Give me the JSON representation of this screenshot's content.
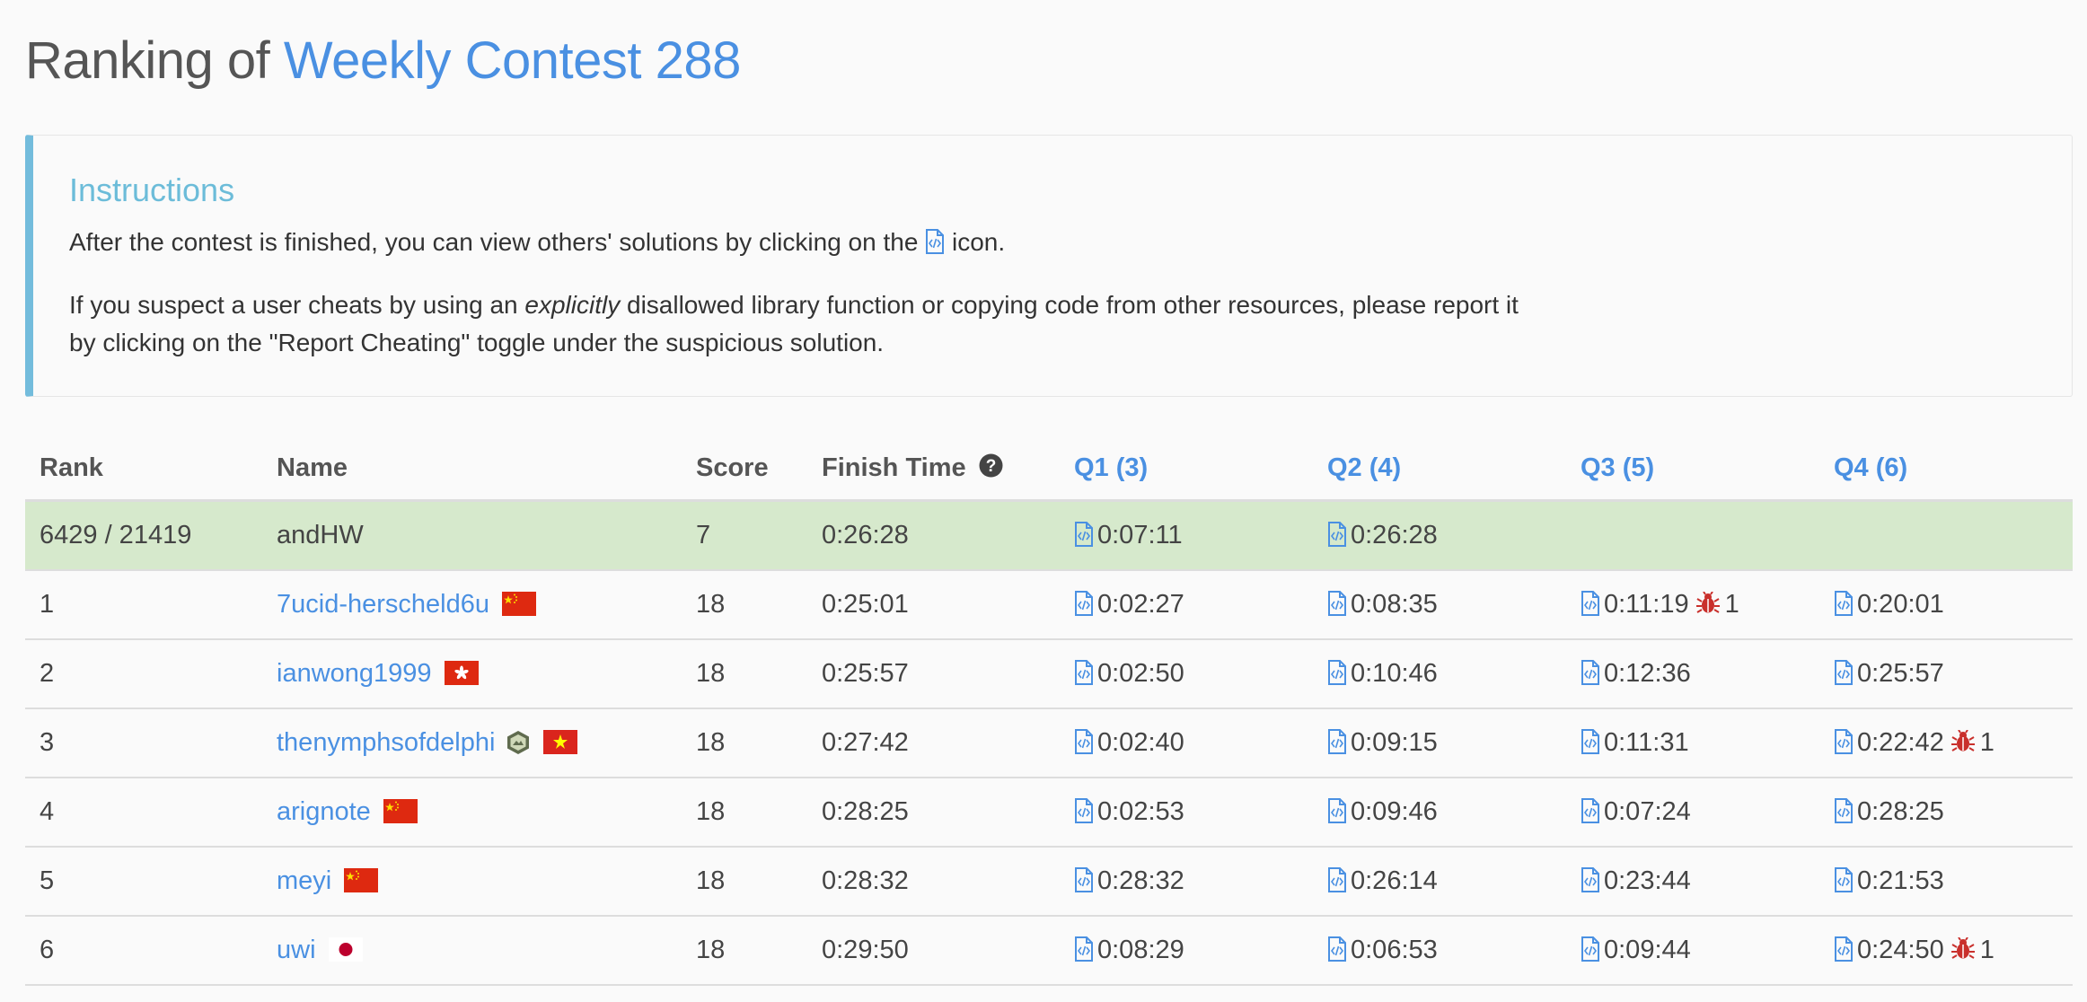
{
  "header": {
    "prefix": "Ranking of",
    "contest": "Weekly Contest 288"
  },
  "instructions": {
    "title": "Instructions",
    "p1_before": "After the contest is finished, you can view others' solutions by clicking on the",
    "p1_after": "icon.",
    "p2_before": "If you suspect a user cheats by using an",
    "p2_em": "explicitly",
    "p2_after": "disallowed library function or copying code from other resources, please report it by clicking on the \"Report Cheating\" toggle under the suspicious solution."
  },
  "table": {
    "headers": {
      "rank": "Rank",
      "name": "Name",
      "score": "Score",
      "finish": "Finish Time",
      "q1": "Q1 (3)",
      "q2": "Q2 (4)",
      "q3": "Q3 (5)",
      "q4": "Q4 (6)"
    },
    "me": {
      "rank": "6429 / 21419",
      "name": "andHW",
      "score": "7",
      "finish": "0:26:28",
      "q1": "0:07:11",
      "q2": "0:26:28",
      "q3": "",
      "q4": ""
    },
    "rows": [
      {
        "rank": "1",
        "name": "7ucid-herscheld6u",
        "flag": "cn-flag-icon",
        "score": "18",
        "finish": "0:25:01",
        "q1": "0:02:27",
        "q2": "0:08:35",
        "q3": "0:11:19",
        "q3_bugs": "1",
        "q4": "0:20:01"
      },
      {
        "rank": "2",
        "name": "ianwong1999",
        "flag": "hk-flag-icon",
        "score": "18",
        "finish": "0:25:57",
        "q1": "0:02:50",
        "q2": "0:10:46",
        "q3": "0:12:36",
        "q4": "0:25:57"
      },
      {
        "rank": "3",
        "name": "thenymphsofdelphi",
        "flag": "vn-flag-icon",
        "badge": "contest-badge-icon",
        "score": "18",
        "finish": "0:27:42",
        "q1": "0:02:40",
        "q2": "0:09:15",
        "q3": "0:11:31",
        "q4": "0:22:42",
        "q4_bugs": "1"
      },
      {
        "rank": "4",
        "name": "arignote",
        "flag": "cn-flag-icon",
        "score": "18",
        "finish": "0:28:25",
        "q1": "0:02:53",
        "q2": "0:09:46",
        "q3": "0:07:24",
        "q4": "0:28:25"
      },
      {
        "rank": "5",
        "name": "meyi",
        "flag": "cn-flag-icon",
        "score": "18",
        "finish": "0:28:32",
        "q1": "0:28:32",
        "q2": "0:26:14",
        "q3": "0:23:44",
        "q4": "0:21:53"
      },
      {
        "rank": "6",
        "name": "uwi",
        "flag": "jp-flag-icon",
        "score": "18",
        "finish": "0:29:50",
        "q1": "0:08:29",
        "q2": "0:06:53",
        "q3": "0:09:44",
        "q4": "0:24:50",
        "q4_bugs": "1"
      }
    ]
  },
  "colors": {
    "accent": "#4a90e2",
    "instructions_border": "#73bcdc",
    "highlight_row": "#d6e9cc",
    "bug": "#c9302c"
  }
}
